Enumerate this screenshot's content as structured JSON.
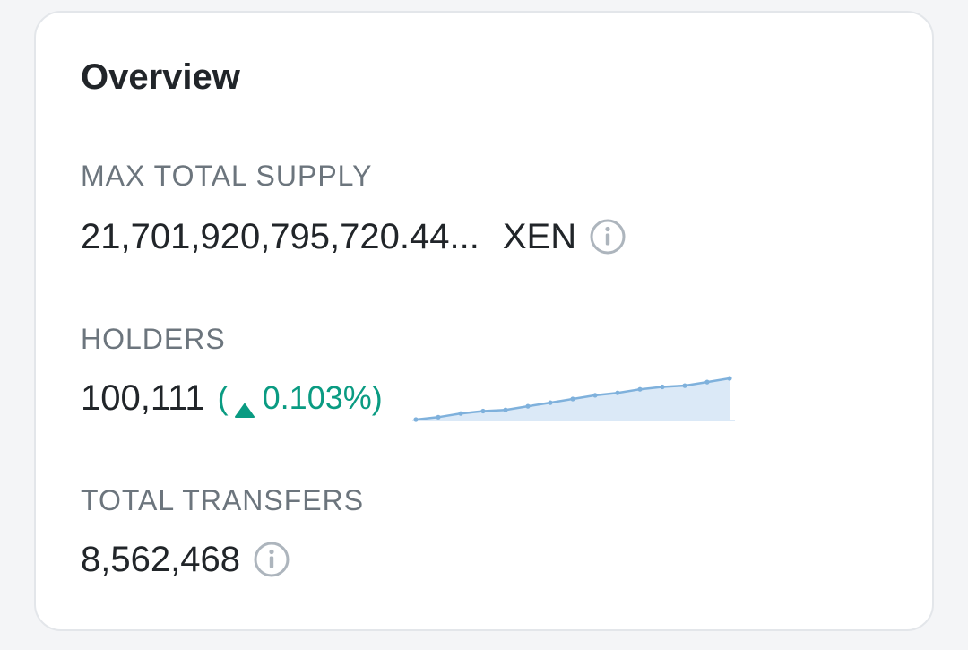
{
  "overview": {
    "title": "Overview",
    "max_total_supply": {
      "label": "MAX TOTAL SUPPLY",
      "value": "21,701,920,795,720.44...",
      "unit": "XEN"
    },
    "holders": {
      "label": "HOLDERS",
      "value": "100,111",
      "change_open": "(",
      "change_value": "0.103%)",
      "change_direction": "up",
      "trend": [
        0,
        1,
        2.5,
        3.5,
        4,
        5.5,
        7,
        8.5,
        10,
        11,
        12.5,
        13.5,
        14,
        15.5,
        17
      ]
    },
    "total_transfers": {
      "label": "TOTAL TRANSFERS",
      "value": "8,562,468"
    }
  },
  "colors": {
    "positive": "#0a9b82",
    "sparkline_line": "#7fb1dc",
    "sparkline_fill": "#dbe9f7",
    "info_icon": "#adb5bd"
  },
  "icons": {
    "supply_info": "info-icon",
    "transfers_info": "info-icon",
    "change_direction": "caret-up-icon"
  }
}
